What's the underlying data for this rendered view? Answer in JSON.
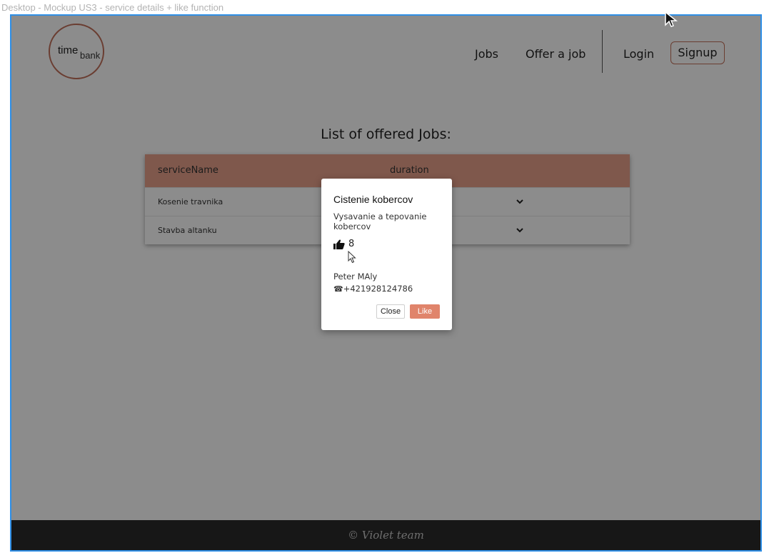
{
  "frame_label": "Desktop - Mockup US3 - service details + like function",
  "logo": {
    "part1": "time",
    "part2": "bank"
  },
  "nav": {
    "jobs": "Jobs",
    "offer": "Offer a job",
    "login": "Login",
    "signup": "Signup"
  },
  "heading": "List of offered Jobs:",
  "table": {
    "columns": [
      "serviceName",
      "duration"
    ],
    "rows": [
      {
        "name": "Kosenie travnika"
      },
      {
        "name": "Stavba altanku"
      }
    ]
  },
  "modal": {
    "title": "Cistenie kobercov",
    "description": "Vysavanie a tepovanie kobercov",
    "likes": "8",
    "user": "Peter MAly",
    "phone": "+421928124786",
    "close_label": "Close",
    "like_label": "Like"
  },
  "footer": "© Violet team",
  "colors": {
    "accent": "#e0846b",
    "header_row": "#e8a08a",
    "frame": "#2f8fe6",
    "footer": "#2a2a2a"
  },
  "icons": [
    "thumbs-up-icon",
    "phone-icon",
    "chevron-down-icon",
    "cursor-icon"
  ]
}
